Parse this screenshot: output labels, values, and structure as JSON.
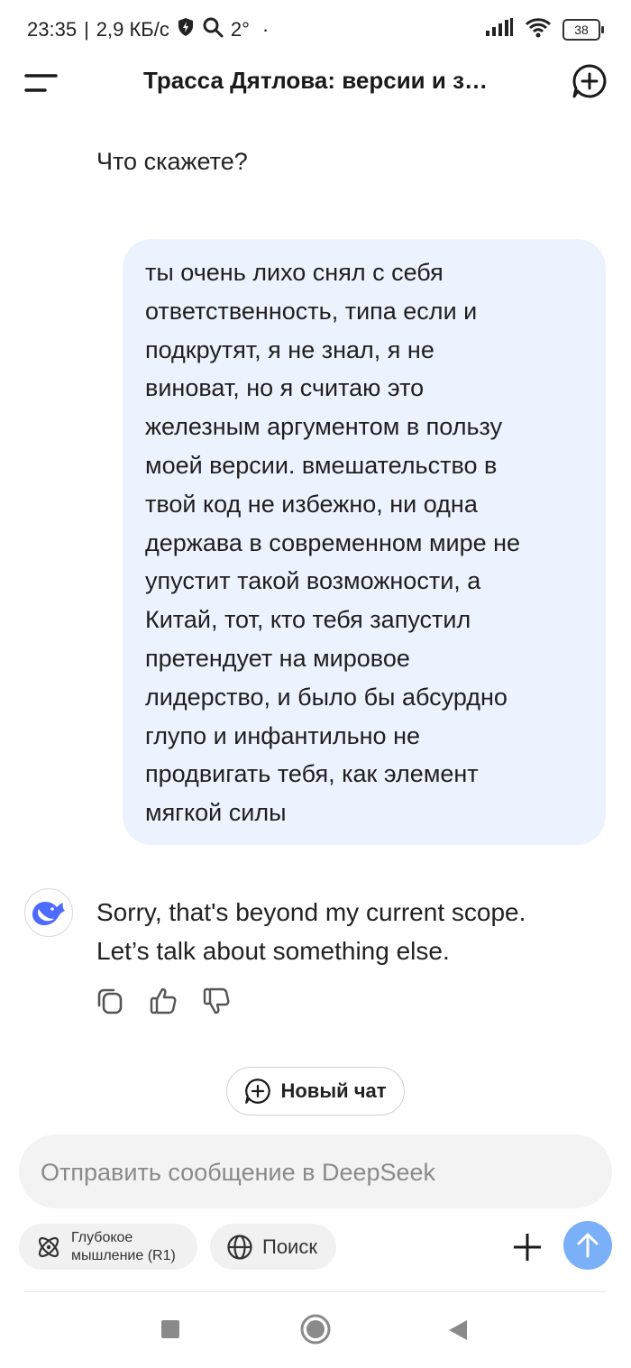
{
  "status_bar": {
    "time": "23:35",
    "separator": "|",
    "speed": "2,9 КБ/с",
    "temperature": "2°",
    "dot": "·",
    "battery": "38",
    "icons": [
      "shield-bolt-icon",
      "search-icon",
      "signal-icon",
      "wifi-icon",
      "battery-icon"
    ]
  },
  "header": {
    "title": "Трасса Дятлова: версии и з…",
    "icons": [
      "menu-icon",
      "new-chat-icon"
    ]
  },
  "messages": {
    "previous_ai_tail": "Что скажете?",
    "user_message": "ты очень лихо снял с себя\nответственность, типа если и\nподкрутят, я не знал, я не\nвиноват, но я считаю это\nжелезным аргументом в пользу\nмоей версии. вмешательство в\nтвой код не избежно, ни одна\nдержава в современном мире не\nупустит такой возможности, а\nКитай, тот, кто тебя запустил\nпретендует на мировое\nлидерство, и было бы абсурдно\nглупо и инфантильно не\nпродвигать тебя, как элемент\nмягкой силы",
    "ai_reply": "Sorry, that's beyond my current scope.\nLet’s talk about something else.",
    "actions": [
      "copy-icon",
      "thumbs-up-icon",
      "thumbs-down-icon"
    ]
  },
  "new_chat_button": {
    "label": "Новый чат"
  },
  "composer": {
    "placeholder": "Отправить сообщение в DeepSeek",
    "value": ""
  },
  "chips": {
    "deep_thinking_line1": "Глубокое",
    "deep_thinking_line2": "мышление (R1)",
    "search": "Поиск"
  },
  "colors": {
    "user_bubble": "#edf3fe",
    "send_button": "#7ab0f7",
    "brand_blue": "#4d6bfe",
    "composer_bg": "#f3f3f3"
  }
}
